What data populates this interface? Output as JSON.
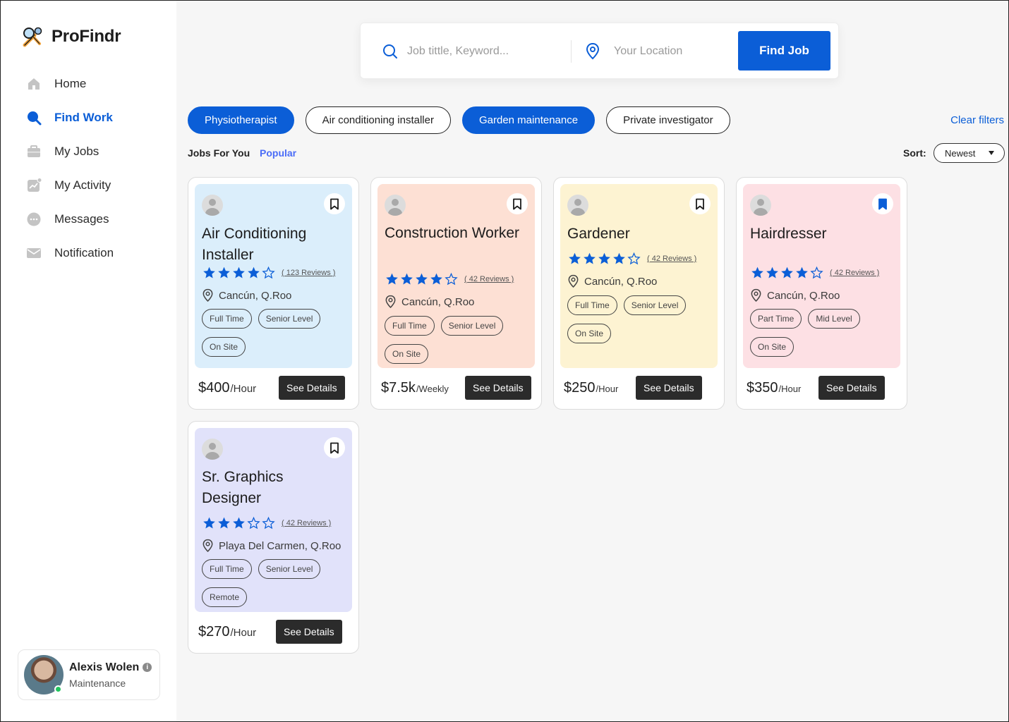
{
  "app": {
    "name": "ProFindr"
  },
  "sidebar": {
    "items": [
      {
        "label": "Home",
        "icon": "home-icon",
        "active": false
      },
      {
        "label": "Find Work",
        "icon": "search-icon",
        "active": true
      },
      {
        "label": "My Jobs",
        "icon": "briefcase-icon",
        "active": false
      },
      {
        "label": "My Activity",
        "icon": "activity-icon",
        "active": false
      },
      {
        "label": "Messages",
        "icon": "chat-icon",
        "active": false
      },
      {
        "label": "Notification",
        "icon": "mail-icon",
        "active": false
      }
    ]
  },
  "profile": {
    "name": "Alexis Wolen",
    "role": "Maintenance",
    "status": "online"
  },
  "search": {
    "keyword_placeholder": "Job tittle, Keyword...",
    "location_placeholder": "Your Location",
    "button_label": "Find Job"
  },
  "filters": {
    "chips": [
      {
        "label": "Physiotherapist",
        "selected": true
      },
      {
        "label": "Air conditioning installer",
        "selected": false
      },
      {
        "label": "Garden maintenance",
        "selected": true
      },
      {
        "label": "Private investigator",
        "selected": false
      }
    ],
    "clear_label": "Clear filters"
  },
  "listing": {
    "section_label": "Jobs For You",
    "popular_label": "Popular",
    "sort_label": "Sort:",
    "sort_value": "Newest"
  },
  "colors": {
    "accent": "#0b5ed7",
    "card_blue": "#dbeefb",
    "card_peach": "#fde0d4",
    "card_yellow": "#fdf3d2",
    "card_pink": "#fde0e4",
    "card_lavender": "#e1e2fa"
  },
  "jobs": [
    {
      "title": "Air Conditioning Installer",
      "rating": 4,
      "reviews": "( 123 Reviews )",
      "location": "Cancún, Q.Roo",
      "tags": [
        "Full Time",
        "Senior Level",
        "On Site"
      ],
      "price": "$400",
      "unit": "/Hour",
      "bookmarked": false,
      "color": "#dbeefb",
      "button": "See Details"
    },
    {
      "title": "Construction Worker",
      "rating": 4,
      "reviews": "( 42 Reviews )",
      "location": "Cancún, Q.Roo",
      "tags": [
        "Full Time",
        "Senior Level",
        "On Site"
      ],
      "price": "$7.5k",
      "unit": "/Weekly",
      "bookmarked": false,
      "color": "#fde0d4",
      "button": "See Details"
    },
    {
      "title": "Gardener",
      "rating": 4,
      "reviews": "( 42 Reviews )",
      "location": "Cancún, Q.Roo",
      "tags": [
        "Full Time",
        "Senior Level",
        "On Site"
      ],
      "price": "$250",
      "unit": "/Hour",
      "bookmarked": false,
      "color": "#fdf3d2",
      "button": "See Details"
    },
    {
      "title": "Hairdresser",
      "rating": 4,
      "reviews": "( 42 Reviews )",
      "location": "Cancún, Q.Roo",
      "tags": [
        "Part Time",
        "Mid Level",
        "On Site"
      ],
      "price": "$350",
      "unit": "/Hour",
      "bookmarked": true,
      "color": "#fde0e4",
      "button": "See Details"
    },
    {
      "title": "Sr. Graphics Designer",
      "rating": 3,
      "reviews": "( 42 Reviews )",
      "location": "Playa Del Carmen, Q.Roo",
      "tags": [
        "Full Time",
        "Senior Level",
        "Remote"
      ],
      "price": "$270",
      "unit": "/Hour",
      "bookmarked": false,
      "color": "#e1e2fa",
      "button": "See Details"
    }
  ]
}
